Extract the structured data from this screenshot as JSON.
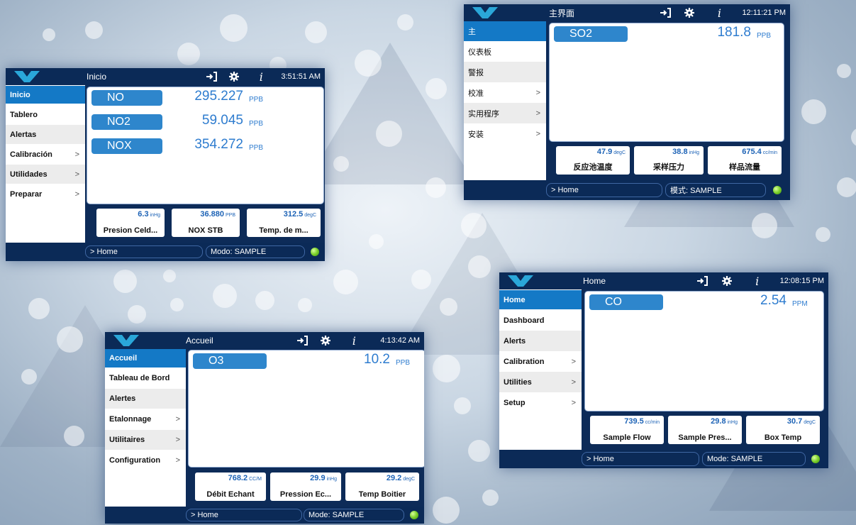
{
  "colors": {
    "header": "#0b2a57",
    "active": "#1479c6",
    "value": "#2e7ccf",
    "led": "#7bcf2a"
  },
  "screens": [
    {
      "title": "Inicio",
      "time": "3:51:51 AM",
      "menu": [
        "Inicio",
        "Tablero",
        "Alertas",
        "Calibración",
        "Utilidades",
        "Preparar"
      ],
      "gases": [
        {
          "name": "NO",
          "value": "295.227",
          "unit": "PPB"
        },
        {
          "name": "NO2",
          "value": "59.045",
          "unit": "PPB"
        },
        {
          "name": "NOX",
          "value": "354.272",
          "unit": "PPB"
        }
      ],
      "metrics": [
        {
          "value": "6.3",
          "unit": "inHg",
          "label": "Presion Celd..."
        },
        {
          "value": "36.880",
          "unit": "PPB",
          "label": "NOX STB"
        },
        {
          "value": "312.5",
          "unit": "degC",
          "label": "Temp. de m..."
        }
      ],
      "breadcrumb": "> Home",
      "mode": "Modo: SAMPLE"
    },
    {
      "title": "主界面",
      "time": "12:11:21 PM",
      "menu": [
        "主",
        "仪表板",
        "警报",
        "校准",
        "实用程序",
        "安装"
      ],
      "gases": [
        {
          "name": "SO2",
          "value": "181.8",
          "unit": "PPB"
        }
      ],
      "metrics": [
        {
          "value": "47.9",
          "unit": "degC",
          "label": "反应池温度"
        },
        {
          "value": "38.8",
          "unit": "inHg",
          "label": "采样压力"
        },
        {
          "value": "675.4",
          "unit": "cc/min",
          "label": "样品流量"
        }
      ],
      "breadcrumb": "> Home",
      "mode": "模式: SAMPLE"
    },
    {
      "title": "Accueil",
      "time": "4:13:42 AM",
      "menu": [
        "Accueil",
        "Tableau de Bord",
        "Alertes",
        "Etalonnage",
        "Utilitaires",
        "Configuration"
      ],
      "gases": [
        {
          "name": "O3",
          "value": "10.2",
          "unit": "PPB"
        }
      ],
      "metrics": [
        {
          "value": "768.2",
          "unit": "CC/M",
          "label": "Débit Echant"
        },
        {
          "value": "29.9",
          "unit": "inHg",
          "label": "Pression Ec..."
        },
        {
          "value": "29.2",
          "unit": "degC",
          "label": "Temp Boitier"
        }
      ],
      "breadcrumb": "> Home",
      "mode": "Mode: SAMPLE"
    },
    {
      "title": "Home",
      "time": "12:08:15 PM",
      "menu": [
        "Home",
        "Dashboard",
        "Alerts",
        "Calibration",
        "Utilities",
        "Setup"
      ],
      "gases": [
        {
          "name": "CO",
          "value": "2.54",
          "unit": "PPM"
        }
      ],
      "metrics": [
        {
          "value": "739.5",
          "unit": "cc/min",
          "label": "Sample Flow"
        },
        {
          "value": "29.8",
          "unit": "inHg",
          "label": "Sample Pres..."
        },
        {
          "value": "30.7",
          "unit": "degC",
          "label": "Box Temp"
        }
      ],
      "breadcrumb": "> Home",
      "mode": "Mode: SAMPLE"
    }
  ]
}
